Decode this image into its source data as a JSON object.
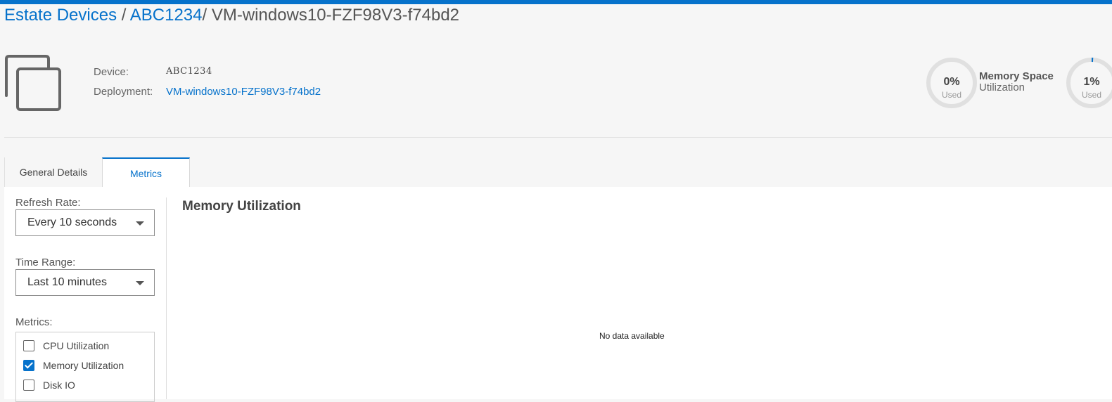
{
  "breadcrumb": {
    "items": [
      "Estate Devices",
      "ABC1234"
    ],
    "separator": "/",
    "current": "VM-windows10-FZF98V3-f74bd2"
  },
  "device_info": {
    "device_label": "Device:",
    "device_value": "ABC1234",
    "deployment_label": "Deployment:",
    "deployment_value": "VM-windows10-FZF98V3-f74bd2"
  },
  "gauges": [
    {
      "percent": "0%",
      "used_label": "Used",
      "fraction": 0.0
    },
    {
      "percent": "1%",
      "used_label": "Used",
      "fraction": 0.01,
      "title_line1": "Memory Space",
      "title_line2": "Utilization"
    }
  ],
  "tabs": [
    {
      "label": "General Details",
      "active": false
    },
    {
      "label": "Metrics",
      "active": true
    }
  ],
  "controls": {
    "refresh_rate_label": "Refresh Rate:",
    "refresh_rate_value": "Every 10 seconds",
    "time_range_label": "Time Range:",
    "time_range_value": "Last 10 minutes",
    "metrics_label": "Metrics:",
    "metrics": [
      {
        "label": "CPU Utilization",
        "checked": false
      },
      {
        "label": "Memory Utilization",
        "checked": true
      },
      {
        "label": "Disk IO",
        "checked": false
      }
    ]
  },
  "chart": {
    "title": "Memory Utilization",
    "empty_message": "No data available"
  },
  "colors": {
    "accent": "#0672cb",
    "gauge_track": "#e0e0e0"
  }
}
